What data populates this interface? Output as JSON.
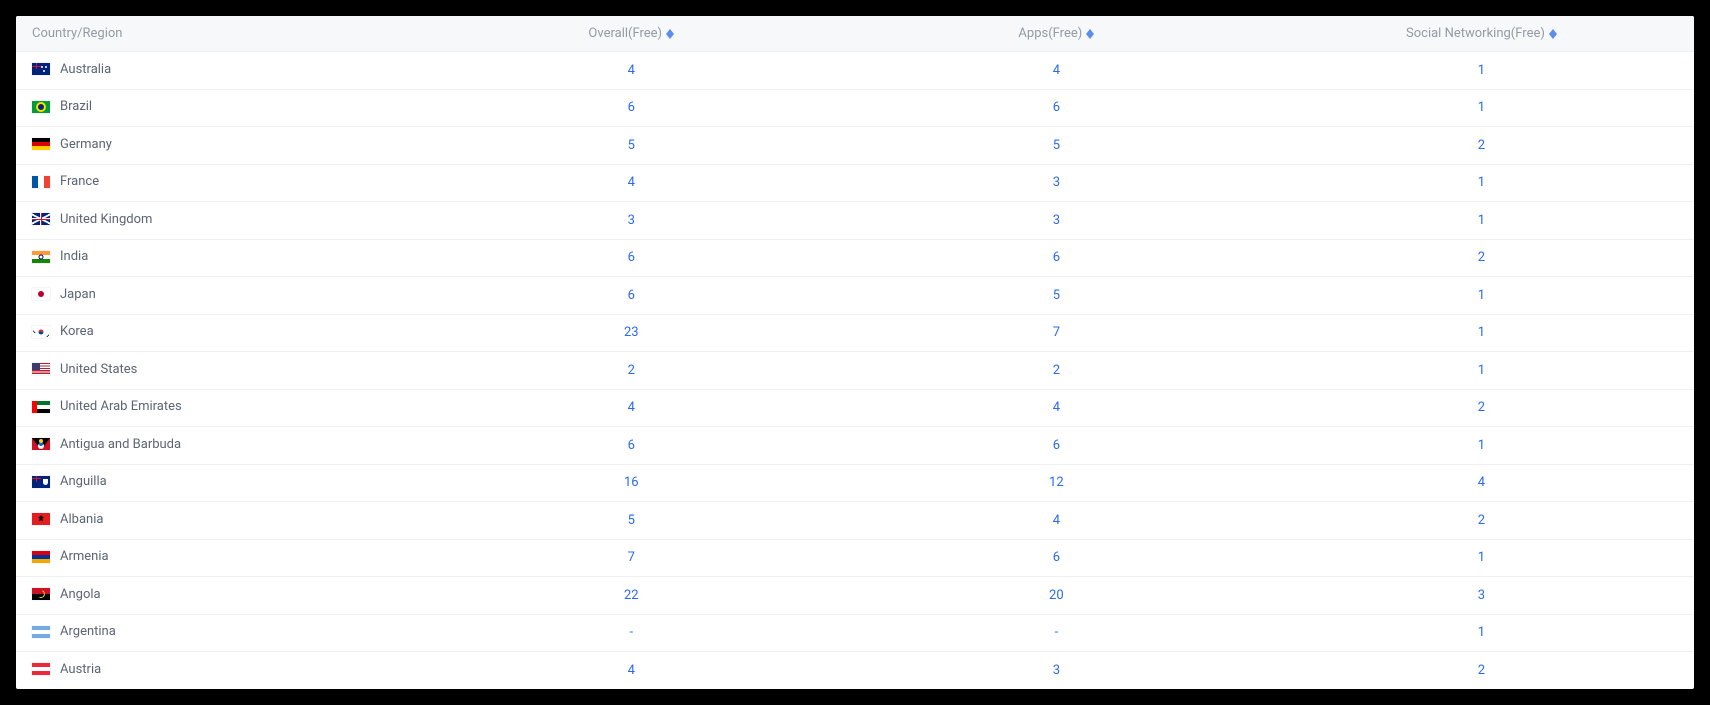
{
  "table": {
    "columns": [
      {
        "key": "country",
        "label": "Country/Region",
        "sortable": false
      },
      {
        "key": "overall",
        "label": "Overall(Free)",
        "sortable": true
      },
      {
        "key": "apps",
        "label": "Apps(Free)",
        "sortable": true
      },
      {
        "key": "social",
        "label": "Social Networking(Free)",
        "sortable": true
      }
    ],
    "rows": [
      {
        "flag": "au",
        "country": "Australia",
        "overall": "4",
        "apps": "4",
        "social": "1"
      },
      {
        "flag": "br",
        "country": "Brazil",
        "overall": "6",
        "apps": "6",
        "social": "1"
      },
      {
        "flag": "de",
        "country": "Germany",
        "overall": "5",
        "apps": "5",
        "social": "2"
      },
      {
        "flag": "fr",
        "country": "France",
        "overall": "4",
        "apps": "3",
        "social": "1"
      },
      {
        "flag": "gb",
        "country": "United Kingdom",
        "overall": "3",
        "apps": "3",
        "social": "1"
      },
      {
        "flag": "in",
        "country": "India",
        "overall": "6",
        "apps": "6",
        "social": "2"
      },
      {
        "flag": "jp",
        "country": "Japan",
        "overall": "6",
        "apps": "5",
        "social": "1"
      },
      {
        "flag": "kr",
        "country": "Korea",
        "overall": "23",
        "apps": "7",
        "social": "1"
      },
      {
        "flag": "us",
        "country": "United States",
        "overall": "2",
        "apps": "2",
        "social": "1"
      },
      {
        "flag": "ae",
        "country": "United Arab Emirates",
        "overall": "4",
        "apps": "4",
        "social": "2"
      },
      {
        "flag": "ag",
        "country": "Antigua and Barbuda",
        "overall": "6",
        "apps": "6",
        "social": "1"
      },
      {
        "flag": "ai",
        "country": "Anguilla",
        "overall": "16",
        "apps": "12",
        "social": "4"
      },
      {
        "flag": "al",
        "country": "Albania",
        "overall": "5",
        "apps": "4",
        "social": "2"
      },
      {
        "flag": "am",
        "country": "Armenia",
        "overall": "7",
        "apps": "6",
        "social": "1"
      },
      {
        "flag": "ao",
        "country": "Angola",
        "overall": "22",
        "apps": "20",
        "social": "3"
      },
      {
        "flag": "ar",
        "country": "Argentina",
        "overall": "-",
        "apps": "-",
        "social": "1"
      },
      {
        "flag": "at",
        "country": "Austria",
        "overall": "4",
        "apps": "3",
        "social": "2"
      }
    ]
  }
}
